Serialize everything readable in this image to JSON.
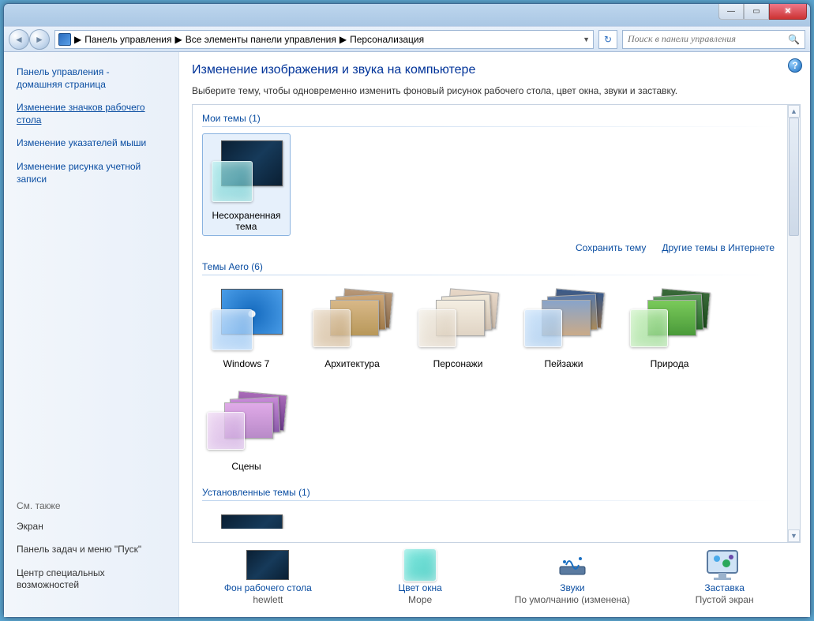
{
  "titlebar": {
    "minimize_glyph": "—",
    "maximize_glyph": "▭",
    "close_glyph": "✕"
  },
  "toolbar": {
    "back_glyph": "◄",
    "fwd_glyph": "►",
    "crumb1": "Панель управления",
    "crumb2": "Все элементы панели управления",
    "crumb3": "Персонализация",
    "sep": "▶",
    "drop": "▼",
    "refresh": "↻",
    "search_placeholder": "Поиск в панели управления",
    "search_icon": "🔍"
  },
  "sidebar": {
    "home1": "Панель управления -",
    "home2": "домашняя страница",
    "link_icons1": "Изменение значков рабочего",
    "link_icons2": "стола",
    "link_pointers": "Изменение указателей мыши",
    "link_acc1": "Изменение рисунка учетной",
    "link_acc2": "записи",
    "seealso": "См. также",
    "see1": "Экран",
    "see2": "Панель задач и меню \"Пуск\"",
    "see3a": "Центр специальных",
    "see3b": "возможностей"
  },
  "main": {
    "help": "?",
    "title": "Изменение изображения и звука на компьютере",
    "lead": "Выберите тему, чтобы одновременно изменить фоновый рисунок рабочего стола, цвет окна, звуки и заставку.",
    "sec_my": "Мои темы (1)",
    "theme_unsaved": "Несохраненная тема",
    "link_save": "Сохранить тему",
    "link_more": "Другие темы в Интернете",
    "sec_aero": "Темы Aero (6)",
    "aero": {
      "win7": "Windows 7",
      "arch": "Архитектура",
      "char": "Персонажи",
      "land": "Пейзажи",
      "nature": "Природа",
      "scenes": "Сцены"
    },
    "sec_installed": "Установленные темы (1)",
    "up": "▲",
    "down": "▼"
  },
  "bottom": {
    "bg_label": "Фон рабочего стола",
    "bg_value": "hewlett",
    "wc_label": "Цвет окна",
    "wc_value": "Море",
    "snd_label": "Звуки",
    "snd_value": "По умолчанию (изменена)",
    "ss_label": "Заставка",
    "ss_value": "Пустой экран"
  }
}
